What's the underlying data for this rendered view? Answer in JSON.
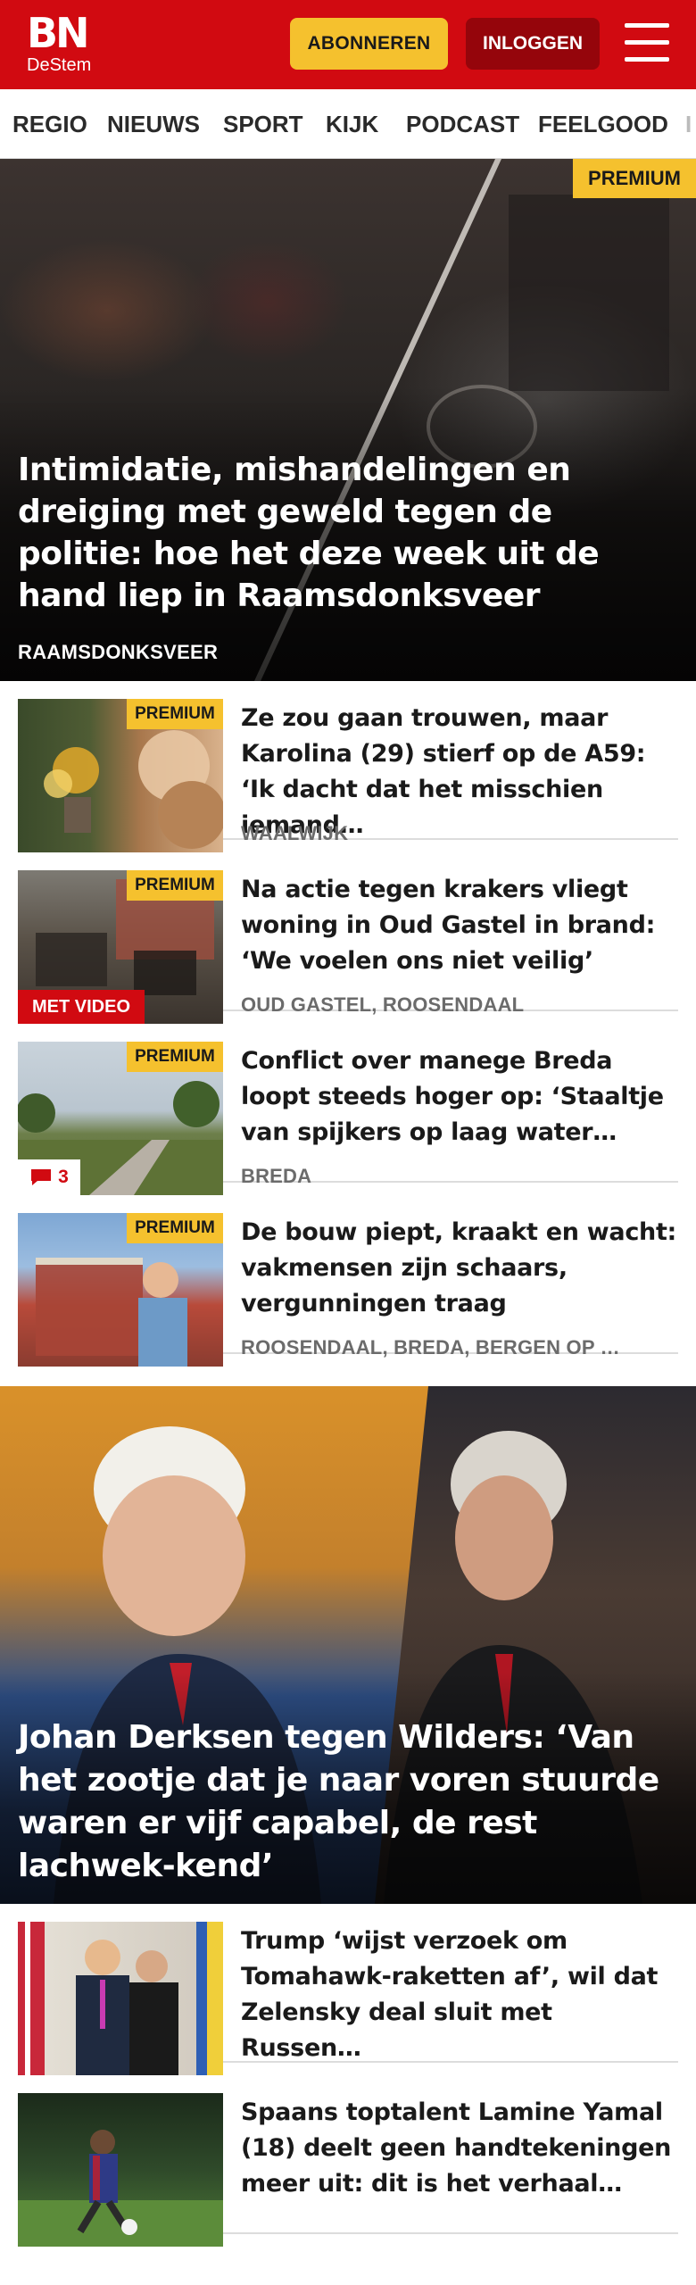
{
  "header": {
    "logo_main": "BN",
    "logo_sub": "DeStem",
    "subscribe_label": "ABONNEREN",
    "login_label": "INLOGGEN",
    "brand_color": "#d10a11",
    "accent_color": "#f5c12e"
  },
  "nav": {
    "items": [
      {
        "label": "REGIO"
      },
      {
        "label": "NIEUWS"
      },
      {
        "label": "SPORT"
      },
      {
        "label": "KIJK"
      },
      {
        "label": "PODCAST"
      },
      {
        "label": "FEELGOOD"
      }
    ]
  },
  "hero": {
    "badge": "PREMIUM",
    "title": "Intimidatie, mishandelingen en dreiging met geweld tegen de politie: hoe het deze week uit de hand liep in Raamsdonksveer",
    "place": "RAAMSDONKSVEER"
  },
  "articles": [
    {
      "badge": "PREMIUM",
      "title": "Ze zou gaan trouwen, maar Karolina (29) stierf op de A59: ‘Ik dacht dat het misschien iemand…",
      "place": "WAALWIJK"
    },
    {
      "badge": "PREMIUM",
      "video_label": "MET VIDEO",
      "title": "Na actie tegen krakers vliegt woning in Oud Gastel in brand: ‘We voelen ons niet veilig’",
      "place": "OUD GASTEL, ROOSENDAAL"
    },
    {
      "badge": "PREMIUM",
      "comment_count": "3",
      "title": "Conflict over manege Breda loopt steeds hoger op: ‘Staaltje van spijkers op laag water…",
      "place": "BREDA"
    },
    {
      "badge": "PREMIUM",
      "title": "De bouw piept, kraakt en wacht: vakmensen zijn schaars, vergunningen traag",
      "place": "ROOSENDAAL, BREDA, BERGEN OP …"
    }
  ],
  "hero2": {
    "title": "Johan Derksen tegen Wilders: ‘Van het zootje dat je naar voren stuurde waren er vijf capabel, de rest lachwek-kend’"
  },
  "articles2": [
    {
      "title": "Trump ‘wijst verzoek om Tomahawk-raketten af’, wil dat Zelensky deal sluit met Russen…"
    },
    {
      "title": "Spaans toptalent Lamine Yamal (18) deelt geen handtekeningen meer uit: dit is het verhaal…"
    }
  ]
}
